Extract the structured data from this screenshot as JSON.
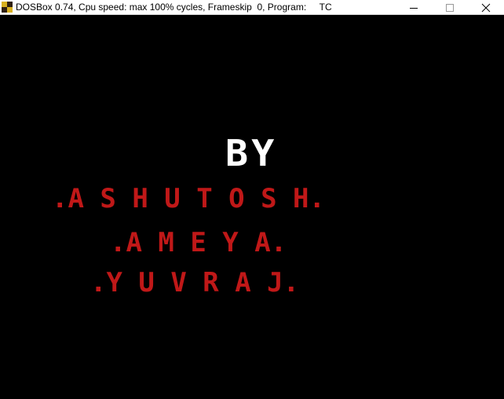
{
  "window": {
    "title": "DOSBox 0.74, Cpu speed: max 100% cycles, Frameskip  0, Program:     TC",
    "controls": {
      "minimize_icon": "minimize-icon",
      "maximize_icon": "maximize-icon",
      "close_icon": "close-icon"
    }
  },
  "screen": {
    "by_text": "BY",
    "names": [
      ".A S H U T O S H.",
      ".A M E Y A.",
      ".Y U V R A J."
    ]
  },
  "colors": {
    "background": "#000000",
    "by_text": "#ffffff",
    "names": "#c01818",
    "titlebar": "#ffffff"
  }
}
